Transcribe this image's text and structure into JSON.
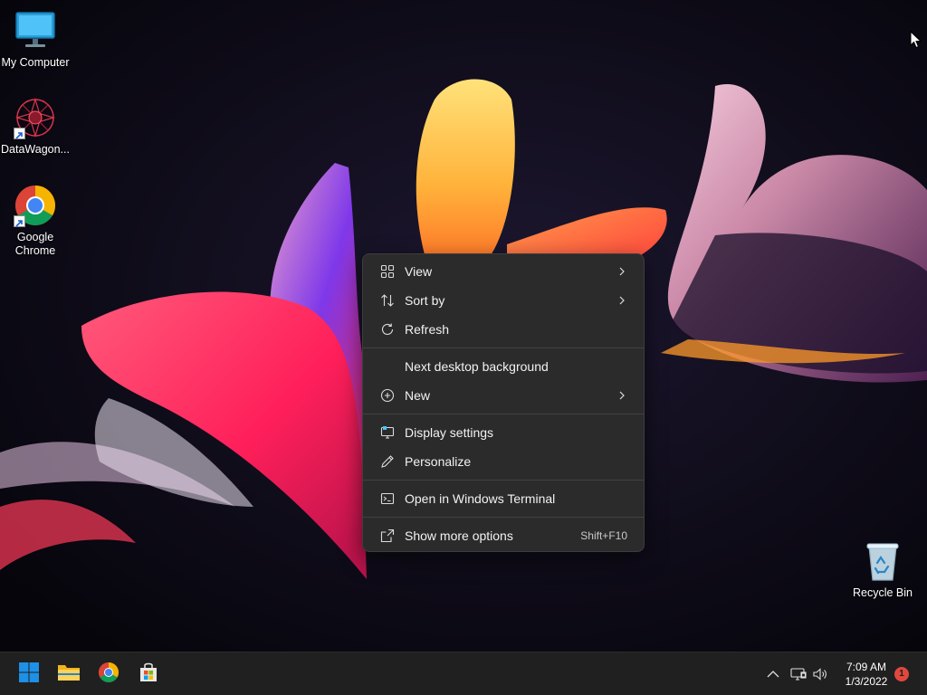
{
  "desktop": {
    "icons": [
      {
        "label": "My Computer",
        "icon": "monitor-icon"
      },
      {
        "label": "DataWagon...",
        "icon": "datawagon-app-icon",
        "shortcut": true
      },
      {
        "label": "Google Chrome",
        "icon": "chrome-icon",
        "shortcut": true
      },
      {
        "label": "Recycle Bin",
        "icon": "recycle-bin-icon"
      }
    ]
  },
  "context_menu": {
    "items": [
      {
        "label": "View",
        "icon": "grid-view-icon",
        "submenu": true
      },
      {
        "label": "Sort by",
        "icon": "sort-arrows-icon",
        "submenu": true
      },
      {
        "label": "Refresh",
        "icon": "refresh-icon"
      },
      {
        "label": "Next desktop background"
      },
      {
        "label": "New",
        "icon": "plus-circle-icon",
        "submenu": true
      },
      {
        "label": "Display settings",
        "icon": "display-settings-icon"
      },
      {
        "label": "Personalize",
        "icon": "pen-icon"
      },
      {
        "label": "Open in Windows Terminal",
        "icon": "terminal-icon"
      },
      {
        "label": "Show more options",
        "icon": "open-external-icon",
        "shortcut": "Shift+F10"
      }
    ]
  },
  "taskbar": {
    "pinned": [
      "windows-start-icon",
      "file-explorer-icon",
      "chrome-icon",
      "microsoft-store-icon"
    ],
    "tray": [
      "chevron-up-icon",
      "network-icon",
      "volume-icon"
    ],
    "clock": {
      "time": "7:09 AM",
      "date": "1/3/2022"
    },
    "notifications": "1"
  },
  "colors": {
    "menu_background": "#2b2b2b",
    "taskbar_background": "#202020",
    "windows_blue": "#1e90e6",
    "notification_badge": "#e0483e"
  }
}
